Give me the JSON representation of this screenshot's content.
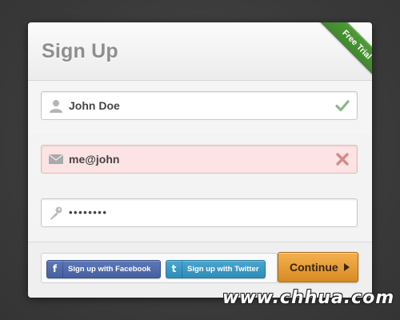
{
  "form": {
    "title": "Sign Up",
    "ribbon": "Free Trial",
    "fields": {
      "name": {
        "value": "John Doe",
        "icon": "user-icon",
        "status": "valid",
        "status_icon": "checkmark-icon"
      },
      "email": {
        "value": "me@john",
        "icon": "envelope-icon",
        "status": "invalid",
        "status_icon": "x-icon"
      },
      "password": {
        "value": "••••••••",
        "icon": "key-icon"
      }
    },
    "buttons": {
      "facebook": {
        "label": "Sign up with Facebook",
        "icon_glyph": "f"
      },
      "twitter": {
        "label": "Sign up with Twitter",
        "icon_glyph": "t"
      },
      "continue": {
        "label": "Continue"
      }
    }
  },
  "watermark": "www.chhua.com",
  "colors": {
    "ribbon_green": "#4a9636",
    "valid_green": "#7fb07f",
    "error_red": "#d98080",
    "error_bg": "#fde3e3",
    "facebook_blue": "#4f6aab",
    "twitter_blue": "#3d99c3",
    "continue_orange": "#e59a33"
  }
}
